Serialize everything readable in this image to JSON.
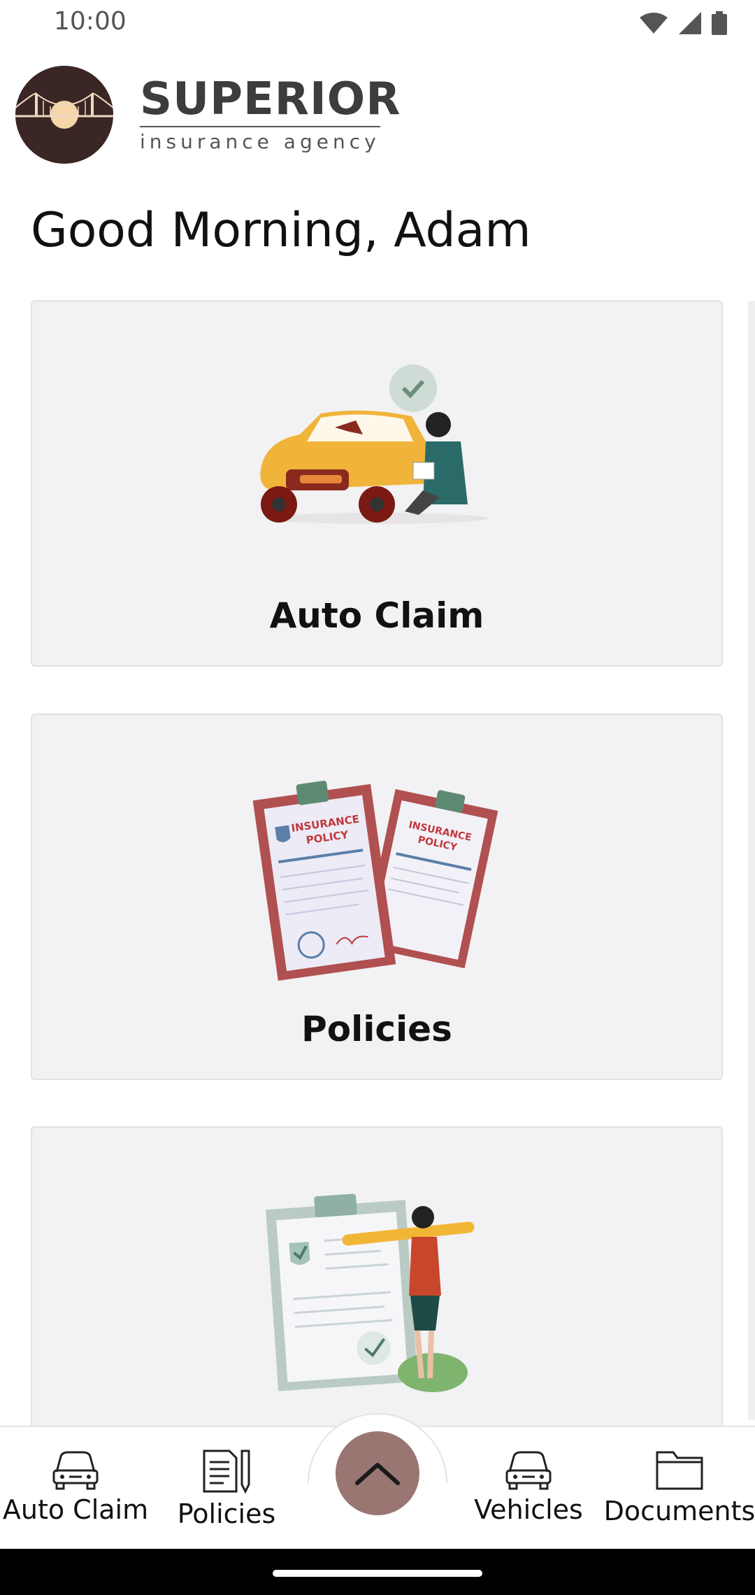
{
  "status_bar": {
    "time": "10:00"
  },
  "header": {
    "brand_name": "SUPERIOR",
    "brand_sub": "insurance agency"
  },
  "greeting": "Good Morning, Adam",
  "cards": [
    {
      "label": "Auto Claim"
    },
    {
      "label": "Policies"
    },
    {
      "label": ""
    }
  ],
  "bottom_nav": {
    "items": [
      {
        "label": "Auto Claim"
      },
      {
        "label": "Policies"
      },
      {
        "label": "Vehicles"
      },
      {
        "label": "Documents"
      }
    ],
    "fab_icon": "chevron-up-icon"
  },
  "colors": {
    "accent": "#9a7673",
    "card_bg": "#f2f1f3",
    "logo_bg": "#3a2624"
  }
}
